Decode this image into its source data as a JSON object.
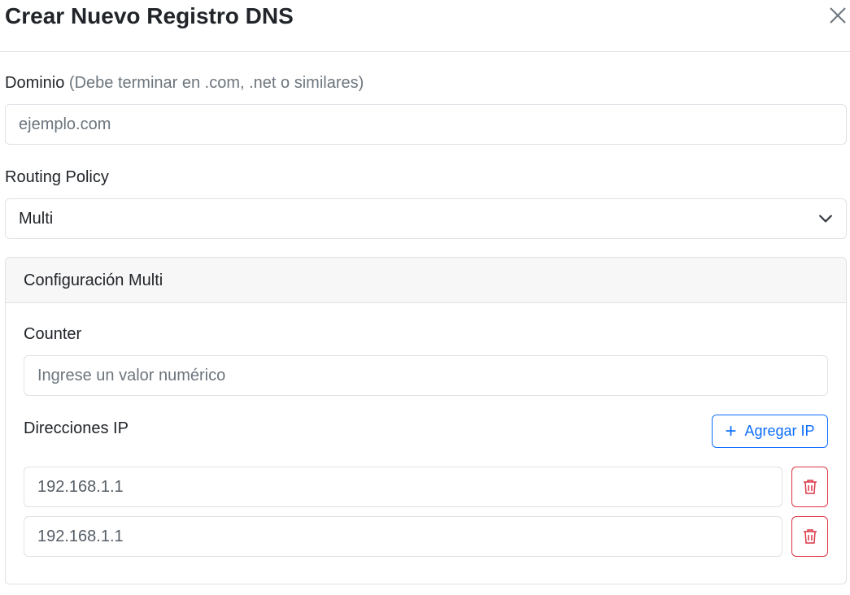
{
  "modal": {
    "title": "Crear Nuevo Registro DNS",
    "close_icon": "close-icon"
  },
  "domain": {
    "label": "Dominio",
    "hint": "(Debe terminar en .com, .net o similares)",
    "placeholder": "ejemplo.com",
    "value": ""
  },
  "routing": {
    "label": "Routing Policy",
    "selected": "Multi",
    "icon": "chevron-down-icon"
  },
  "multi_config": {
    "title": "Configuración Multi",
    "counter": {
      "label": "Counter",
      "placeholder": "Ingrese un valor numérico",
      "value": ""
    },
    "ips": {
      "label": "Direcciones IP",
      "add_button": "Agregar IP",
      "add_icon": "plus-icon",
      "delete_icon": "trash-icon",
      "items": [
        {
          "value": "192.168.1.1"
        },
        {
          "value": "192.168.1.1"
        }
      ]
    }
  },
  "colors": {
    "primary": "#0d6efd",
    "danger": "#dc3545",
    "border": "#dee2e6",
    "muted": "#6c757d",
    "card_header_bg": "#f7f7f7"
  }
}
